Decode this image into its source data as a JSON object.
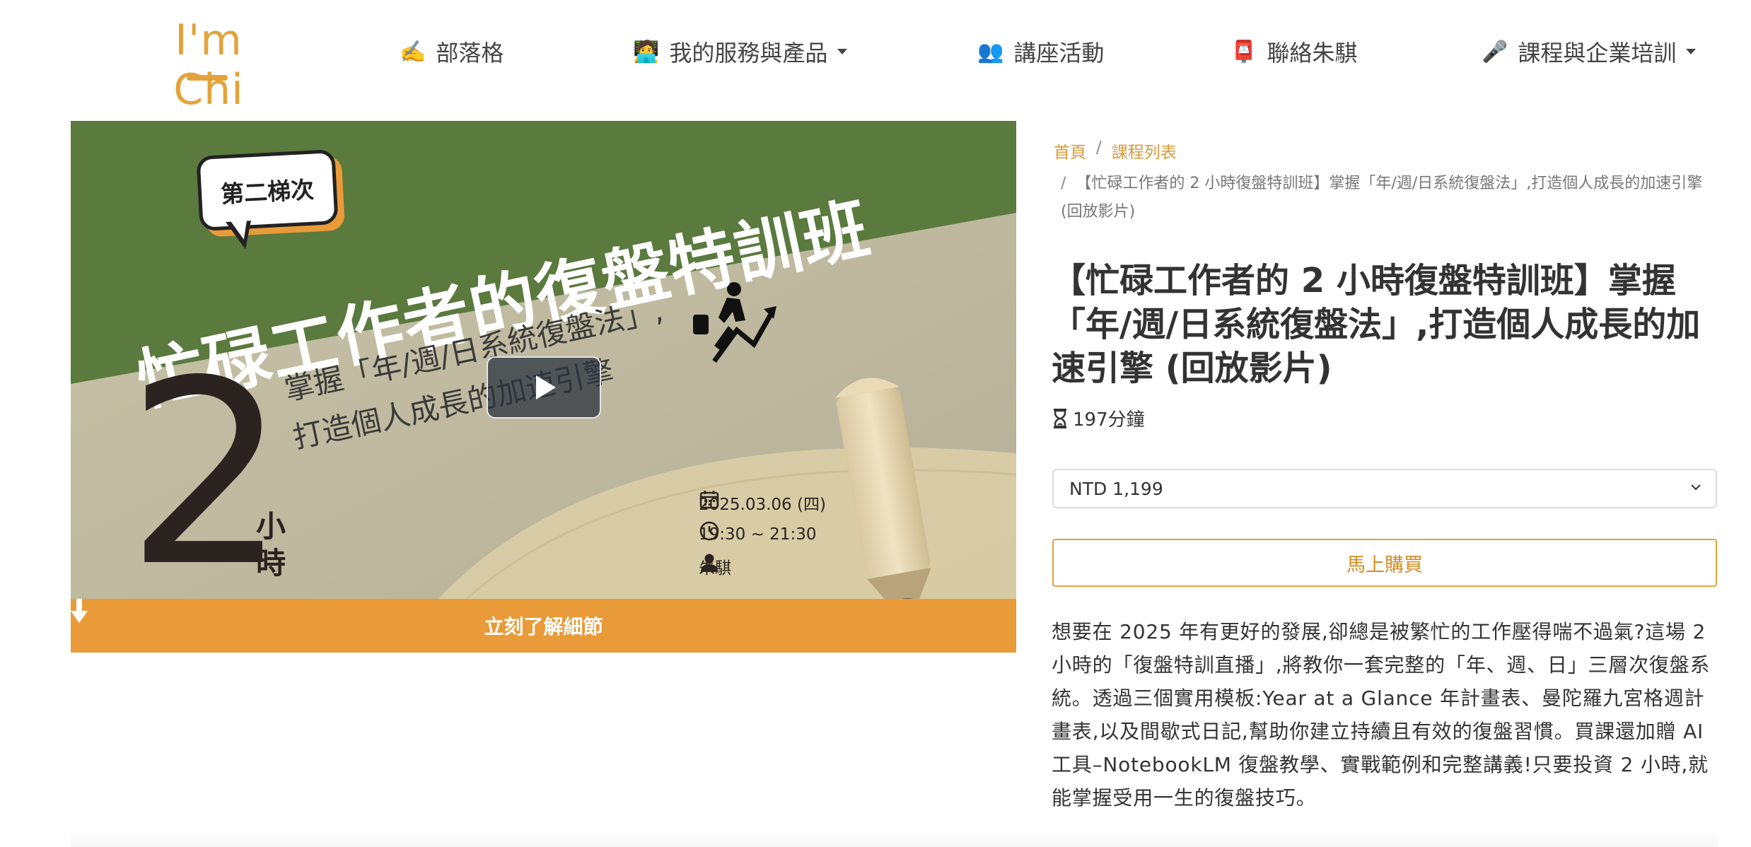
{
  "header": {
    "logo": "I'm Chi",
    "nav": [
      {
        "emoji": "✍️",
        "label": "部落格",
        "dropdown": false
      },
      {
        "emoji": "🧑‍💻",
        "label": "我的服務與產品",
        "dropdown": true
      },
      {
        "emoji": "👥",
        "label": "講座活動",
        "dropdown": false
      },
      {
        "emoji": "📮",
        "label": "聯絡朱騏",
        "dropdown": false
      },
      {
        "emoji": "🎤",
        "label": "課程與企業培訓",
        "dropdown": true
      }
    ]
  },
  "hero": {
    "badge": "第二梯次",
    "title": "忙碌工作者的復盤特訓班",
    "subtitle_line1": "掌握「年/週/日系統復盤法」,",
    "subtitle_line2": "打造個人成長的加速引擎",
    "big_number": "2",
    "hours_label": "小時",
    "date": "2025.03.06 (四)",
    "time": "19:30 ~ 21:30",
    "instructor": "朱騏",
    "cta": "立刻了解細節",
    "cta_icon": "arrow-down-icon",
    "colors": {
      "green": "#5a7a3e",
      "orange": "#e89b38",
      "paper": "#d9cfae"
    }
  },
  "breadcrumb": {
    "home": "首頁",
    "list": "課程列表",
    "separator": "/",
    "current": "【忙碌工作者的 2 小時復盤特訓班】掌握「年/週/日系統復盤法」,打造個人成長的加速引擎 (回放影片)"
  },
  "course": {
    "title": "【忙碌工作者的 2 小時復盤特訓班】掌握「年/週/日系統復盤法」,打造個人成長的加速引擎 (回放影片)",
    "duration": "197分鐘",
    "price_option": "NTD 1,199",
    "buy_label": "馬上購買",
    "description": "想要在 2025 年有更好的發展,卻總是被繁忙的工作壓得喘不過氣?這場 2 小時的「復盤特訓直播」,將教你一套完整的「年、週、日」三層次復盤系統。透過三個實用模板:Year at a Glance 年計畫表、曼陀羅九宮格週計畫表,以及間歇式日記,幫助你建立持續且有效的復盤習慣。買課還加贈 AI 工具–NotebookLM 復盤教學、實戰範例和完整講義!只要投資 2 小時,就能掌握受用一生的復盤技巧。"
  },
  "theme": {
    "accent": "#e3a33a"
  }
}
